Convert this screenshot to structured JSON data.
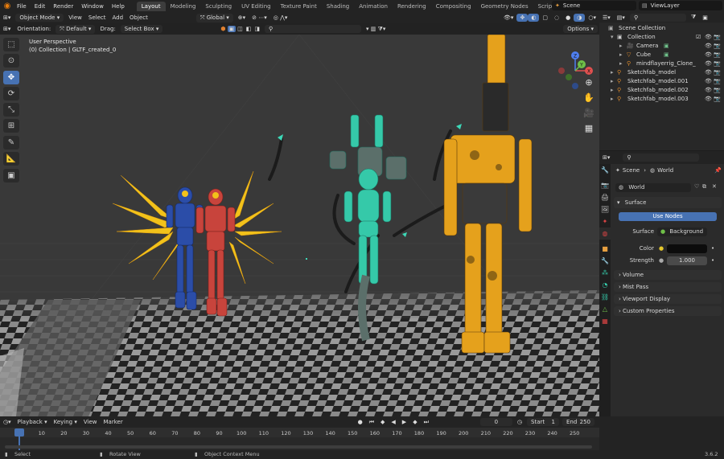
{
  "menu": [
    "File",
    "Edit",
    "Render",
    "Window",
    "Help"
  ],
  "workspaces": [
    "Layout",
    "Modeling",
    "Sculpting",
    "UV Editing",
    "Texture Paint",
    "Shading",
    "Animation",
    "Rendering",
    "Compositing",
    "Geometry Nodes",
    "Scripting"
  ],
  "active_workspace": "Layout",
  "scene_name": "Scene",
  "view_layer": "ViewLayer",
  "viewport": {
    "mode": "Object Mode",
    "menus": [
      "View",
      "Select",
      "Add",
      "Object"
    ],
    "transform_orientation": "Global",
    "orientation_label": "Orientation:",
    "orientation_value": "Default",
    "drag_label": "Drag:",
    "drag_value": "Select Box",
    "options": "Options",
    "overlay_title": "User Perspective",
    "overlay_subtitle": "(0) Collection | GLTF_created_0",
    "axis_x": "X",
    "axis_y": "Y",
    "axis_z": "Z"
  },
  "outliner": {
    "rows": [
      {
        "label": "Scene Collection",
        "depth": 0
      },
      {
        "label": "Collection",
        "depth": 1
      },
      {
        "label": "Camera",
        "depth": 2
      },
      {
        "label": "Cube",
        "depth": 2
      },
      {
        "label": "mindflayerrig_Clone_",
        "depth": 2
      },
      {
        "label": "Sketchfab_model",
        "depth": 1
      },
      {
        "label": "Sketchfab_model.001",
        "depth": 1
      },
      {
        "label": "Sketchfab_model.002",
        "depth": 1
      },
      {
        "label": "Sketchfab_model.003",
        "depth": 1
      }
    ]
  },
  "properties": {
    "breadcrumb_scene": "Scene",
    "breadcrumb_world": "World",
    "world_name": "World",
    "surface_panel": "Surface",
    "use_nodes": "Use Nodes",
    "surface_label": "Surface",
    "surface_value": "Background",
    "color_label": "Color",
    "strength_label": "Strength",
    "strength_value": "1.000",
    "collapsed_panels": [
      "Volume",
      "Mist Pass",
      "Viewport Display",
      "Custom Properties"
    ]
  },
  "timeline": {
    "menus": [
      "Playback",
      "Keying",
      "View",
      "Marker"
    ],
    "current_frame": "0",
    "start_label": "Start",
    "start_value": "1",
    "end_label": "End",
    "end_value": "250",
    "ticks": [
      "0",
      "10",
      "20",
      "30",
      "40",
      "50",
      "60",
      "70",
      "80",
      "90",
      "100",
      "110",
      "120",
      "130",
      "140",
      "150",
      "160",
      "170",
      "180",
      "190",
      "200",
      "210",
      "220",
      "230",
      "240",
      "250"
    ]
  },
  "status": {
    "select": "Select",
    "rotate": "Rotate View",
    "context": "Object Context Menu",
    "version": "3.6.2"
  },
  "colors": {
    "accent": "#4772b3",
    "orange": "#e87d0d",
    "yellow_robot": "#e5a11c",
    "teal_robot": "#35c9a9",
    "blue_robot": "#2b4da8",
    "red_robot": "#c8443c"
  }
}
